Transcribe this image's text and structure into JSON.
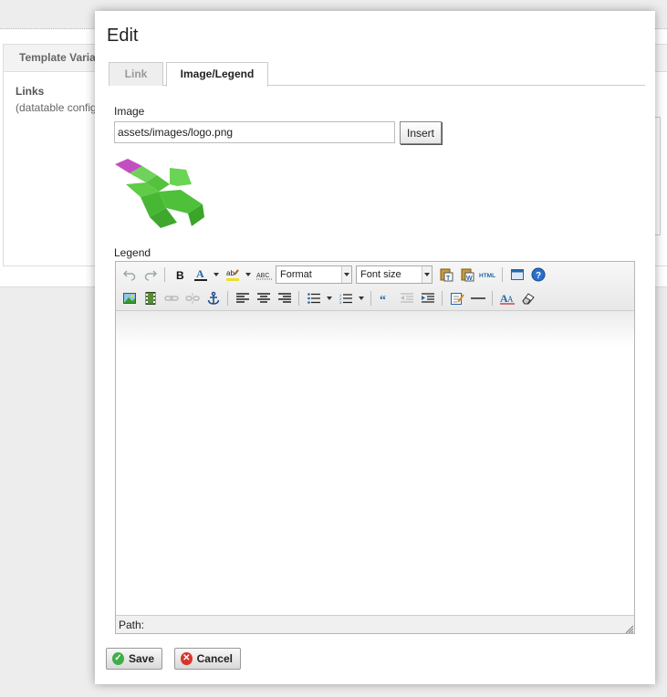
{
  "background": {
    "panel_title": "Template Varia",
    "links_label": "Links",
    "links_sub": "(datatable config"
  },
  "dialog": {
    "title": "Edit",
    "tabs": [
      {
        "label": "Link",
        "active": false
      },
      {
        "label": "Image/Legend",
        "active": true
      }
    ],
    "image_label": "Image",
    "image_value": "assets/images/logo.png",
    "insert_label": "Insert",
    "legend_label": "Legend",
    "editor": {
      "format_select": "Format",
      "fontsize_select": "Font size",
      "html_button": "HTML",
      "path_label": "Path:",
      "toolbar_row1": [
        "undo-icon",
        "redo-icon",
        "bold-icon",
        "text-color-icon",
        "highlight-color-icon",
        "spellcheck-icon",
        "format-select",
        "font-size-select",
        "paste-text-icon",
        "paste-word-icon",
        "html-source-icon",
        "fullscreen-icon",
        "help-icon"
      ],
      "toolbar_row2": [
        "image-icon",
        "media-icon",
        "link-icon",
        "unlink-icon",
        "anchor-icon",
        "align-left-icon",
        "align-center-icon",
        "align-right-icon",
        "bullet-list-icon",
        "numbered-list-icon",
        "blockquote-icon",
        "outdent-icon",
        "indent-icon",
        "edit-icon",
        "horizontal-rule-icon",
        "styles-icon",
        "clear-format-icon"
      ]
    },
    "save_label": "Save",
    "cancel_label": "Cancel",
    "colors": {
      "save_icon": "#3fae49",
      "cancel_icon": "#d9342b",
      "accent": "#2266aa"
    }
  }
}
